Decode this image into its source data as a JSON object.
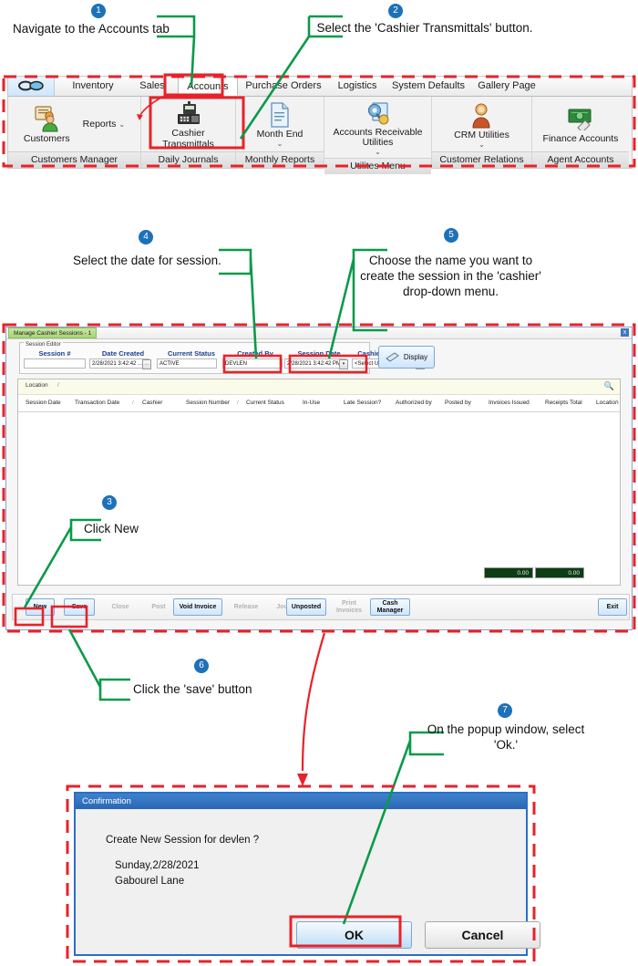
{
  "annotations": [
    {
      "num": "1",
      "text": "Navigate to the Accounts tab"
    },
    {
      "num": "2",
      "text": "Select the 'Cashier Transmittals' button."
    },
    {
      "num": "3",
      "text": "Click New"
    },
    {
      "num": "4",
      "text": "Select the date for session."
    },
    {
      "num": "5",
      "text": "Choose the name you want to create the session in the 'cashier' drop-down menu."
    },
    {
      "num": "6",
      "text": "Click the 'save' button"
    },
    {
      "num": "7",
      "text": "On the popup window, select 'Ok.'"
    }
  ],
  "ribbon": {
    "tabs": [
      {
        "label": "Inventory",
        "selected": false
      },
      {
        "label": "Sales",
        "selected": false
      },
      {
        "label": "Accounts",
        "selected": true
      },
      {
        "label": "Purchase Orders",
        "selected": false
      },
      {
        "label": "Logistics",
        "selected": false
      },
      {
        "label": "System Defaults",
        "selected": false
      },
      {
        "label": "Gallery Page",
        "selected": false
      }
    ],
    "groups": [
      {
        "label": "Customers Manager",
        "buttons": [
          {
            "label": "Customers",
            "icon": "customers-icon",
            "caret": false
          },
          {
            "label": "Reports",
            "icon": "reports-icon",
            "caret": true
          }
        ]
      },
      {
        "label": "Daily Journals",
        "buttons": [
          {
            "label": "Cashier Transmittals",
            "icon": "cash-register-icon",
            "caret": false
          }
        ]
      },
      {
        "label": "Monthly Reports",
        "buttons": [
          {
            "label": "Month End",
            "icon": "document-icon",
            "caret": true
          }
        ]
      },
      {
        "label": "Utilites Menu",
        "buttons": [
          {
            "label": "Accounts Receivable Utilities",
            "icon": "ar-utilities-icon",
            "caret": true
          }
        ]
      },
      {
        "label": "Customer Relations",
        "buttons": [
          {
            "label": "CRM Utilities",
            "icon": "crm-icon",
            "caret": true
          }
        ]
      },
      {
        "label": "Agent Accounts",
        "buttons": [
          {
            "label": "Finance Accounts",
            "icon": "money-icon",
            "caret": false
          }
        ]
      }
    ]
  },
  "window": {
    "tab_title": "Manage Cashier Sessions - 1",
    "close_label": "x",
    "editor": {
      "caption": "Session Editor",
      "fields": [
        {
          "header": "Session #",
          "value": "",
          "dropdown": false
        },
        {
          "header": "Date Created",
          "value": "2/28/2021 3:42:42 ...",
          "dropdown": true
        },
        {
          "header": "Current Status",
          "value": "ACTIVE",
          "dropdown": false
        },
        {
          "header": "Created By",
          "value": "DEVLEN",
          "dropdown": false
        },
        {
          "header": "Session Date",
          "value": "2/28/2021 3:42:42 PM",
          "dropdown": true
        },
        {
          "header": "Cashier",
          "value": "<Select User Group>",
          "dropdown": true
        }
      ],
      "display_button": "Display",
      "display_icon": "display-icon"
    },
    "grid": {
      "filter_label": "Location",
      "filter_sort": "/",
      "search_icon": "search-icon",
      "columns": [
        "Session Date",
        "Transaction Date",
        "/",
        "Cashier",
        "Session Number",
        "/",
        "Current Status",
        "In-Use",
        "Late Session?",
        "Authorized by",
        "Posted by",
        "Invoices Issued",
        "Receipts Total",
        "Location",
        "/"
      ],
      "rows": [],
      "totals": [
        "0.00",
        "0.00"
      ]
    },
    "toolbar": [
      {
        "label": "New",
        "state": "on"
      },
      {
        "label": "Save",
        "state": "on"
      },
      {
        "label": "Close",
        "state": "off"
      },
      {
        "label": "Post",
        "state": "off"
      },
      {
        "label": "Void Invoice",
        "state": "on"
      },
      {
        "label": "Release",
        "state": "off"
      },
      {
        "label": "Journals",
        "state": "off"
      },
      {
        "label": "Unposted",
        "state": "on"
      },
      {
        "label": "Print Invoices",
        "state": "off"
      },
      {
        "label": "Cash Manager",
        "state": "on"
      },
      {
        "label": "Exit",
        "state": "on"
      }
    ]
  },
  "dialog": {
    "title": "Confirmation",
    "message": "Create New Session for devlen  ?",
    "line1": "Sunday,2/28/2021",
    "line2": "Gabourel Lane",
    "ok_label": "OK",
    "cancel_label": "Cancel"
  },
  "colors": {
    "badge": "#1d71b8",
    "callout_green": "#0a9a4a",
    "highlight_red": "#e8222a",
    "flow_red": "#e8222a",
    "dialog_title": "#2a66b5",
    "total_green": "#0d3d14"
  }
}
